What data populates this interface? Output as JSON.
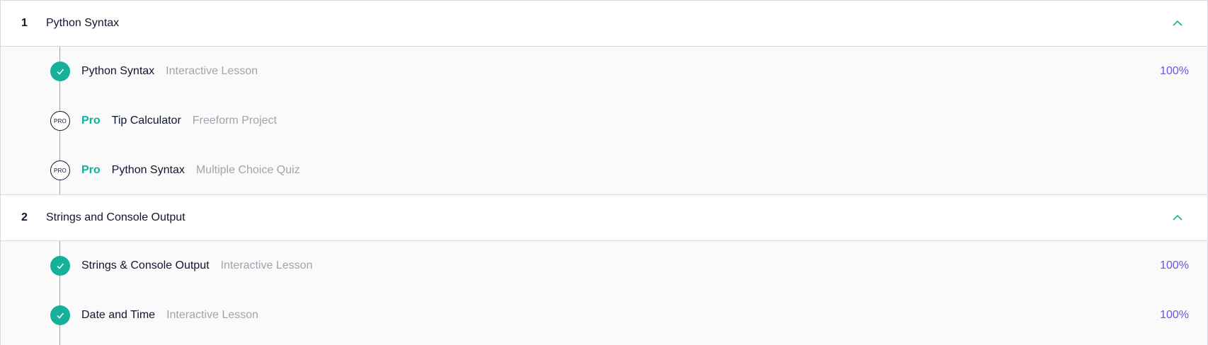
{
  "modules": [
    {
      "number": "1",
      "title": "Python Syntax",
      "items": [
        {
          "status": "completed",
          "pro_label": "",
          "title": "Python Syntax",
          "type": "Interactive Lesson",
          "progress": "100%"
        },
        {
          "status": "pro",
          "badge": "PRO",
          "pro_label": "Pro",
          "title": "Tip Calculator",
          "type": "Freeform Project",
          "progress": ""
        },
        {
          "status": "pro",
          "badge": "PRO",
          "pro_label": "Pro",
          "title": "Python Syntax",
          "type": "Multiple Choice Quiz",
          "progress": ""
        }
      ]
    },
    {
      "number": "2",
      "title": "Strings and Console Output",
      "items": [
        {
          "status": "completed",
          "pro_label": "",
          "title": "Strings & Console Output",
          "type": "Interactive Lesson",
          "progress": "100%"
        },
        {
          "status": "completed",
          "pro_label": "",
          "title": "Date and Time",
          "type": "Interactive Lesson",
          "progress": "100%"
        }
      ]
    }
  ],
  "icons": {
    "completed": "checkmark-icon",
    "collapse": "chevron-up-icon"
  },
  "colors": {
    "accent_green": "#15b09a",
    "progress_purple": "#6b52e6",
    "navy": "#10162f",
    "muted_gray": "#a0a4ad"
  }
}
